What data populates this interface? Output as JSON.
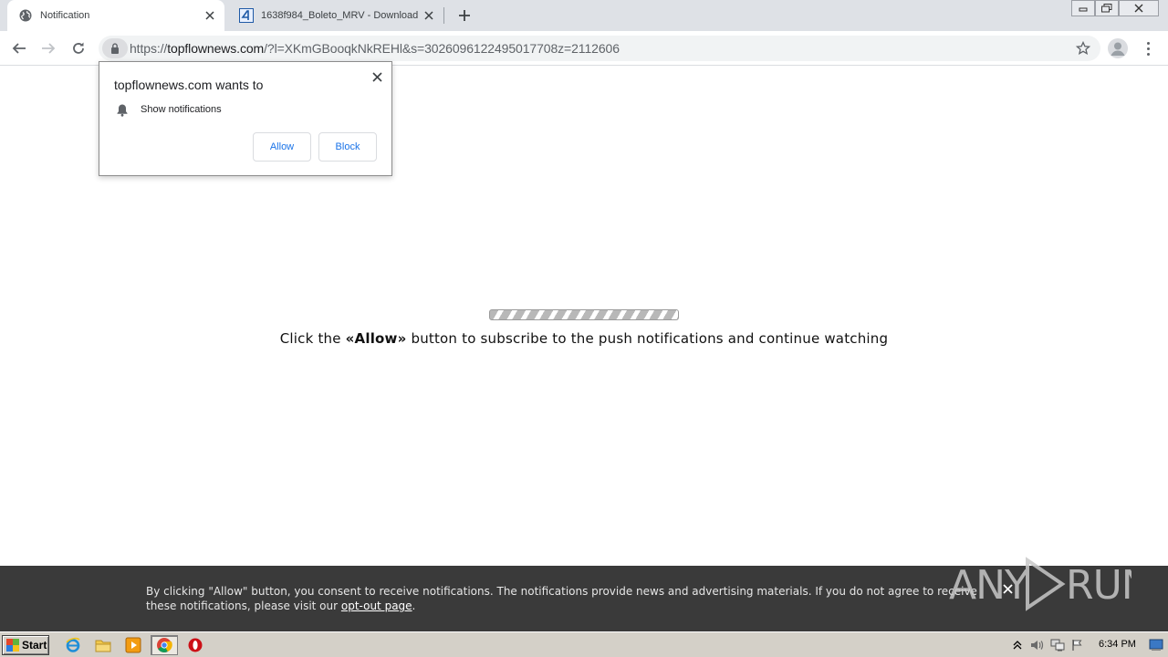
{
  "browser": {
    "tabs": [
      {
        "title": "Notification",
        "active": true,
        "favicon": "globe-icon"
      },
      {
        "title": "1638f984_Boleto_MRV - Download -",
        "active": false,
        "favicon": "download-site-icon"
      }
    ],
    "url": {
      "scheme": "https://",
      "host": "topflownews.com",
      "path": "/?l=XKmGBooqkNkREHl&s=3026096122495017708z=2112606"
    }
  },
  "permission_prompt": {
    "title": "topflownews.com wants to",
    "permission": "Show notifications",
    "allow_label": "Allow",
    "block_label": "Block"
  },
  "page": {
    "message_before": "Click the ",
    "message_bold": "«Allow»",
    "message_after": " button to subscribe to the push notifications and continue watching"
  },
  "banner": {
    "text": "By clicking \"Allow\" button, you consent to receive notifications. The notifications provide news and advertising materials. If you do not agree to receive these notifications, please visit our ",
    "link": "opt-out page",
    "tail": "."
  },
  "watermark": "ANY RUN",
  "taskbar": {
    "start_label": "Start",
    "clock": "6:34 PM"
  },
  "colors": {
    "accent": "#1a73e8",
    "banner_bg": "#3a3a3a",
    "tabstrip_bg": "#dee1e6"
  }
}
